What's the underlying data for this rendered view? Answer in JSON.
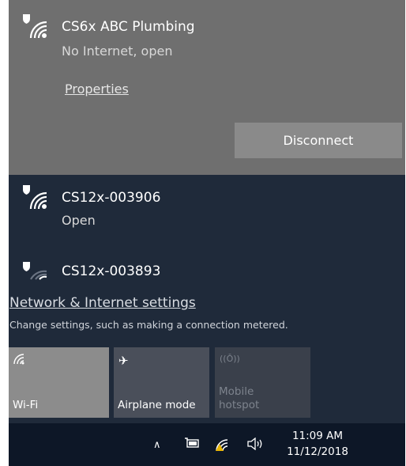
{
  "connected_network": {
    "name": "CS6x ABC Plumbing",
    "status": "No Internet, open",
    "properties_label": "Properties",
    "disconnect_label": "Disconnect"
  },
  "available_networks": [
    {
      "name": "CS12x-003906",
      "status": "Open"
    },
    {
      "name": "CS12x-003893",
      "status": ""
    }
  ],
  "settings": {
    "link_label": "Network & Internet settings",
    "description": "Change settings, such as making a connection metered."
  },
  "quick_actions": [
    {
      "icon": "wifi-icon",
      "label": "Wi-Fi",
      "active": true
    },
    {
      "icon": "airplane-icon",
      "label": "Airplane mode",
      "active": false
    },
    {
      "icon": "mobile-hotspot-icon",
      "label": "Mobile\nhotspot",
      "active": false,
      "disabled": true
    }
  ],
  "taskbar": {
    "tray_icons": [
      "chevron-up-icon",
      "battery-icon",
      "wifi-warning-icon",
      "volume-icon"
    ],
    "time": "11:09 AM",
    "date": "11/12/2018"
  },
  "colors": {
    "connected_bg": "#6f6f6f",
    "flyout_bg": "#1f2a3a",
    "taskbar_bg": "#0d1727",
    "warning": "#e8b400"
  }
}
